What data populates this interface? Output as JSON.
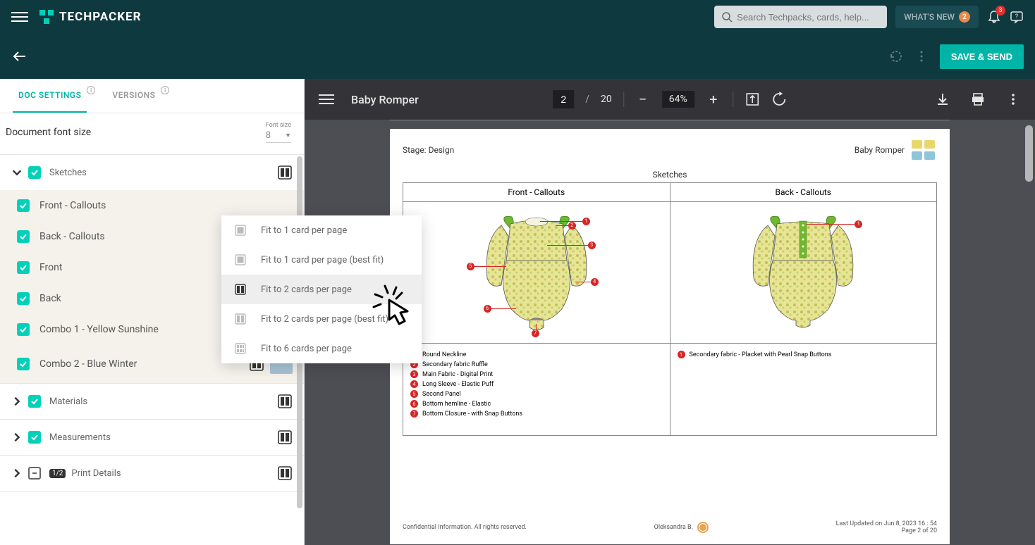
{
  "header": {
    "logo_text": "TECHPACKER",
    "search_placeholder": "Search Techpacks, cards, help...",
    "whatsnew_label": "WHAT'S NEW",
    "whatsnew_count": "2",
    "notif_count": "3"
  },
  "action_bar": {
    "save_label": "SAVE & SEND"
  },
  "sidebar": {
    "tabs": {
      "doc_settings": "DOC SETTINGS",
      "versions": "VERSIONS"
    },
    "font_size_label": "Document font size",
    "font_size_caption": "Font size",
    "font_size_value": "8",
    "sections": {
      "sketches": {
        "title": "Sketches",
        "items": [
          {
            "label": "Front - Callouts"
          },
          {
            "label": "Back - Callouts"
          },
          {
            "label": "Front"
          },
          {
            "label": "Back"
          },
          {
            "label": "Combo 1 - Yellow Sunshine"
          },
          {
            "label": "Combo 2 - Blue Winter"
          }
        ]
      },
      "materials": {
        "title": "Materials"
      },
      "measurements": {
        "title": "Measurements"
      },
      "print_details": {
        "title": "Print Details",
        "fraction": "1/2"
      }
    }
  },
  "context_menu": {
    "items": [
      {
        "label": "Fit to 1 card per page"
      },
      {
        "label": "Fit to 1 card per page (best fit)"
      },
      {
        "label": "Fit to 2 cards per page"
      },
      {
        "label": "Fit to 2 cards per page (best fit)"
      },
      {
        "label": "Fit to 6 cards per page"
      }
    ]
  },
  "pdf": {
    "title": "Baby Romper",
    "page_current": "2",
    "page_sep": "/",
    "page_total": "20",
    "zoom": "64%"
  },
  "page": {
    "stage_label": "Stage: Design",
    "doc_name": "Baby Romper",
    "section_title": "Sketches",
    "col1": "Front - Callouts",
    "col2": "Back - Callouts",
    "front_callouts": [
      {
        "n": "1",
        "text": "Round Neckline"
      },
      {
        "n": "2",
        "text": "Secondary fabric Ruffle"
      },
      {
        "n": "3",
        "text": "Main Fabric - Digital Print"
      },
      {
        "n": "4",
        "text": "Long Sleeve - Elastic Puff"
      },
      {
        "n": "5",
        "text": "Second Panel"
      },
      {
        "n": "6",
        "text": "Bottom hemline - Elastic"
      },
      {
        "n": "7",
        "text": "Bottom Closure - with Snap Buttons"
      }
    ],
    "back_callouts": [
      {
        "n": "1",
        "text": "Secondary fabric - Placket with Pearl Snap Buttons"
      }
    ],
    "footer_left": "Confidential Information. All rights reserved.",
    "footer_center": "Oleksandra B.",
    "footer_right_1": "Last Updated on Jun 8, 2023 16 : 54",
    "footer_right_2": "Page 2 of 20"
  }
}
